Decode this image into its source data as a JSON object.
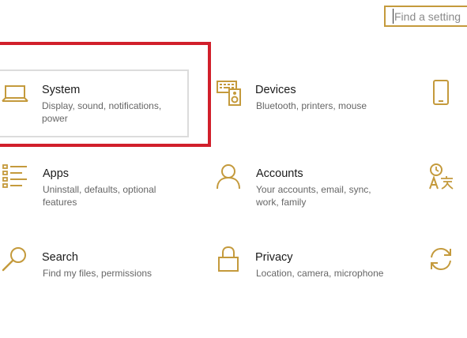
{
  "search": {
    "placeholder": "Find a setting"
  },
  "tiles": [
    {
      "id": "system",
      "title": "System",
      "desc": "Display, sound, notifications, power",
      "icon": "laptop-icon"
    },
    {
      "id": "devices",
      "title": "Devices",
      "desc": "Bluetooth, printers, mouse",
      "icon": "keyboard-speaker-icon"
    },
    {
      "id": "phone",
      "title": "",
      "desc": "",
      "icon": "phone-icon"
    },
    {
      "id": "apps",
      "title": "Apps",
      "desc": "Uninstall, defaults, optional features",
      "icon": "apps-list-icon"
    },
    {
      "id": "accounts",
      "title": "Accounts",
      "desc": "Your accounts, email, sync, work, family",
      "icon": "person-icon"
    },
    {
      "id": "time-language",
      "title": "",
      "desc": "",
      "icon": "time-language-icon"
    },
    {
      "id": "search",
      "title": "Search",
      "desc": "Find my files, permissions",
      "icon": "magnifier-icon"
    },
    {
      "id": "privacy",
      "title": "Privacy",
      "desc": "Location, camera, microphone",
      "icon": "lock-icon"
    },
    {
      "id": "update",
      "title": "",
      "desc": "",
      "icon": "update-sync-icon"
    }
  ],
  "colors": {
    "accent": "#c49a3c",
    "highlight": "#d11f2b"
  }
}
